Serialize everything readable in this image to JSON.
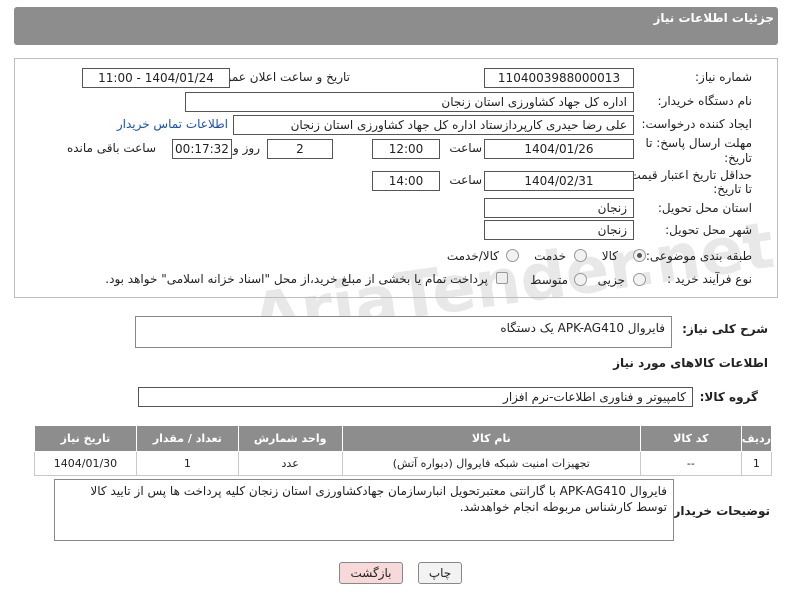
{
  "header": {
    "title": "جزئیات اطلاعات نیاز"
  },
  "form": {
    "need_number_label": "شماره نیاز:",
    "need_number": "1104003988000013",
    "announce_label": "تاریخ و ساعت اعلان عمومی:",
    "announce_value": "1404/01/24 - 11:00",
    "buyer_org_label": "نام دستگاه خریدار:",
    "buyer_org": "اداره کل جهاد کشاورزی استان زنجان",
    "creator_label": "ایجاد کننده درخواست:",
    "creator": "علی رضا حیدری کارپردازستاد اداره کل جهاد کشاورزی استان زنجان",
    "contact_link": "اطلاعات تماس خریدار",
    "deadline_label_1": "مهلت ارسال پاسخ: تا",
    "deadline_label_2": "تاریخ:",
    "deadline_date": "1404/01/26",
    "time_label": "ساعت",
    "deadline_time": "12:00",
    "days_value": "2",
    "days_label": "روز و",
    "remaining_time": "00:17:32",
    "remaining_label": "ساعت باقی مانده",
    "validity_label_1": "حداقل تاریخ اعتبار قیمت:",
    "validity_label_2": "تا تاریخ:",
    "validity_date": "1404/02/31",
    "validity_time": "14:00",
    "province_label": "استان محل تحویل:",
    "province": "زنجان",
    "city_label": "شهر محل تحویل:",
    "city": "زنجان",
    "category_label": "طبقه بندی موضوعی:",
    "category_options": [
      "کالا",
      "خدمت",
      "کالا/خدمت"
    ],
    "purchase_type_label": "نوع فرآیند خرید :",
    "purchase_options": [
      "جزیی",
      "متوسط"
    ],
    "payment_note": "پرداخت تمام یا بخشی از مبلغ خرید،از محل \"اسناد خزانه اسلامی\" خواهد بود."
  },
  "description": {
    "label": "شرح کلی نیاز:",
    "text": "فایروال APK-AG410 یک دستگاه"
  },
  "goods": {
    "section_title": "اطلاعات کالاهای مورد نیاز",
    "group_label": "گروه کالا:",
    "group_value": "کامپیوتر و فناوری اطلاعات-نرم افزار",
    "columns": [
      "ردیف",
      "کد کالا",
      "نام کالا",
      "واحد شمارش",
      "تعداد / مقدار",
      "تاریخ نیاز"
    ],
    "rows": [
      [
        "1",
        "--",
        "تجهیزات امنیت شبکه فایروال (دیواره آتش)",
        "عدد",
        "1",
        "1404/01/30"
      ]
    ]
  },
  "buyer_notes": {
    "label": "توضیحات خریدار:",
    "text": "فایروال APK-AG410 با گارانتی معتبرتحویل انبارسازمان جهادکشاورزی استان زنجان  کلیه پرداخت ها پس از تایید کالا توسط کارشناس مربوطه انجام خواهدشد."
  },
  "buttons": {
    "print": "چاپ",
    "back": "بازگشت"
  },
  "watermark": "AriaTender.net"
}
